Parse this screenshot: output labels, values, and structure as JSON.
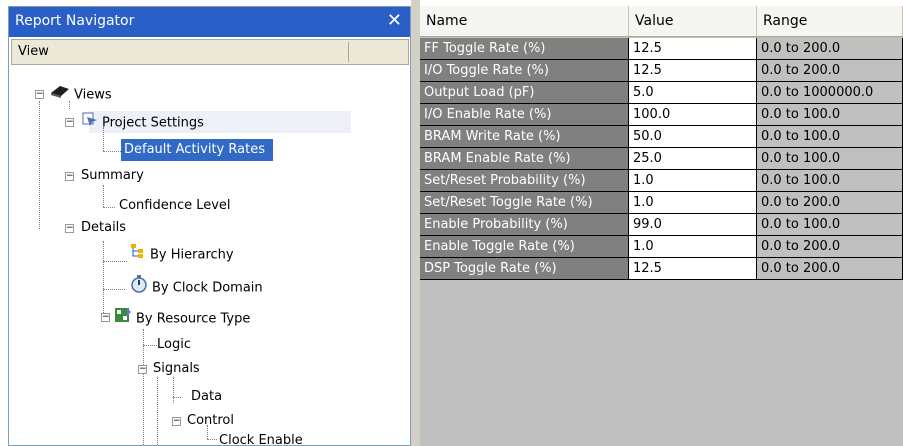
{
  "navigator": {
    "title": "Report Navigator",
    "close_glyph": "✕",
    "view_label": "View",
    "tree": {
      "views": "Views",
      "project_settings": "Project Settings",
      "default_activity_rates": "Default Activity Rates",
      "summary": "Summary",
      "confidence_level": "Confidence Level",
      "details": "Details",
      "by_hierarchy": "By Hierarchy",
      "by_clock_domain": "By Clock Domain",
      "by_resource_type": "By Resource Type",
      "logic": "Logic",
      "signals": "Signals",
      "data": "Data",
      "control": "Control",
      "clock_enable": "Clock Enable"
    }
  },
  "grid": {
    "columns": [
      "Name",
      "Value",
      "Range"
    ],
    "rows": [
      {
        "name": "FF Toggle Rate (%)",
        "value": "12.5",
        "range": "0.0 to 200.0"
      },
      {
        "name": "I/O Toggle Rate (%)",
        "value": "12.5",
        "range": "0.0 to 200.0"
      },
      {
        "name": "Output Load (pF)",
        "value": "5.0",
        "range": "0.0 to 1000000.0"
      },
      {
        "name": "I/O Enable Rate (%)",
        "value": "100.0",
        "range": "0.0 to 100.0"
      },
      {
        "name": "BRAM Write Rate (%)",
        "value": "50.0",
        "range": "0.0 to 100.0"
      },
      {
        "name": "BRAM Enable Rate (%)",
        "value": "25.0",
        "range": "0.0 to 100.0"
      },
      {
        "name": "Set/Reset Probability (%)",
        "value": "1.0",
        "range": "0.0 to 100.0"
      },
      {
        "name": "Set/Reset Toggle Rate (%)",
        "value": "1.0",
        "range": "0.0 to 200.0"
      },
      {
        "name": "Enable Probability (%)",
        "value": "99.0",
        "range": "0.0 to 100.0"
      },
      {
        "name": "Enable Toggle Rate (%)",
        "value": "1.0",
        "range": "0.0 to 200.0"
      },
      {
        "name": "DSP Toggle Rate (%)",
        "value": "12.5",
        "range": "0.0 to 200.0"
      }
    ]
  },
  "colors": {
    "title_bar": "#2a5fc7",
    "selection": "#316ac5",
    "name_cell": "#808080",
    "grid_background": "#c0c0c0"
  }
}
